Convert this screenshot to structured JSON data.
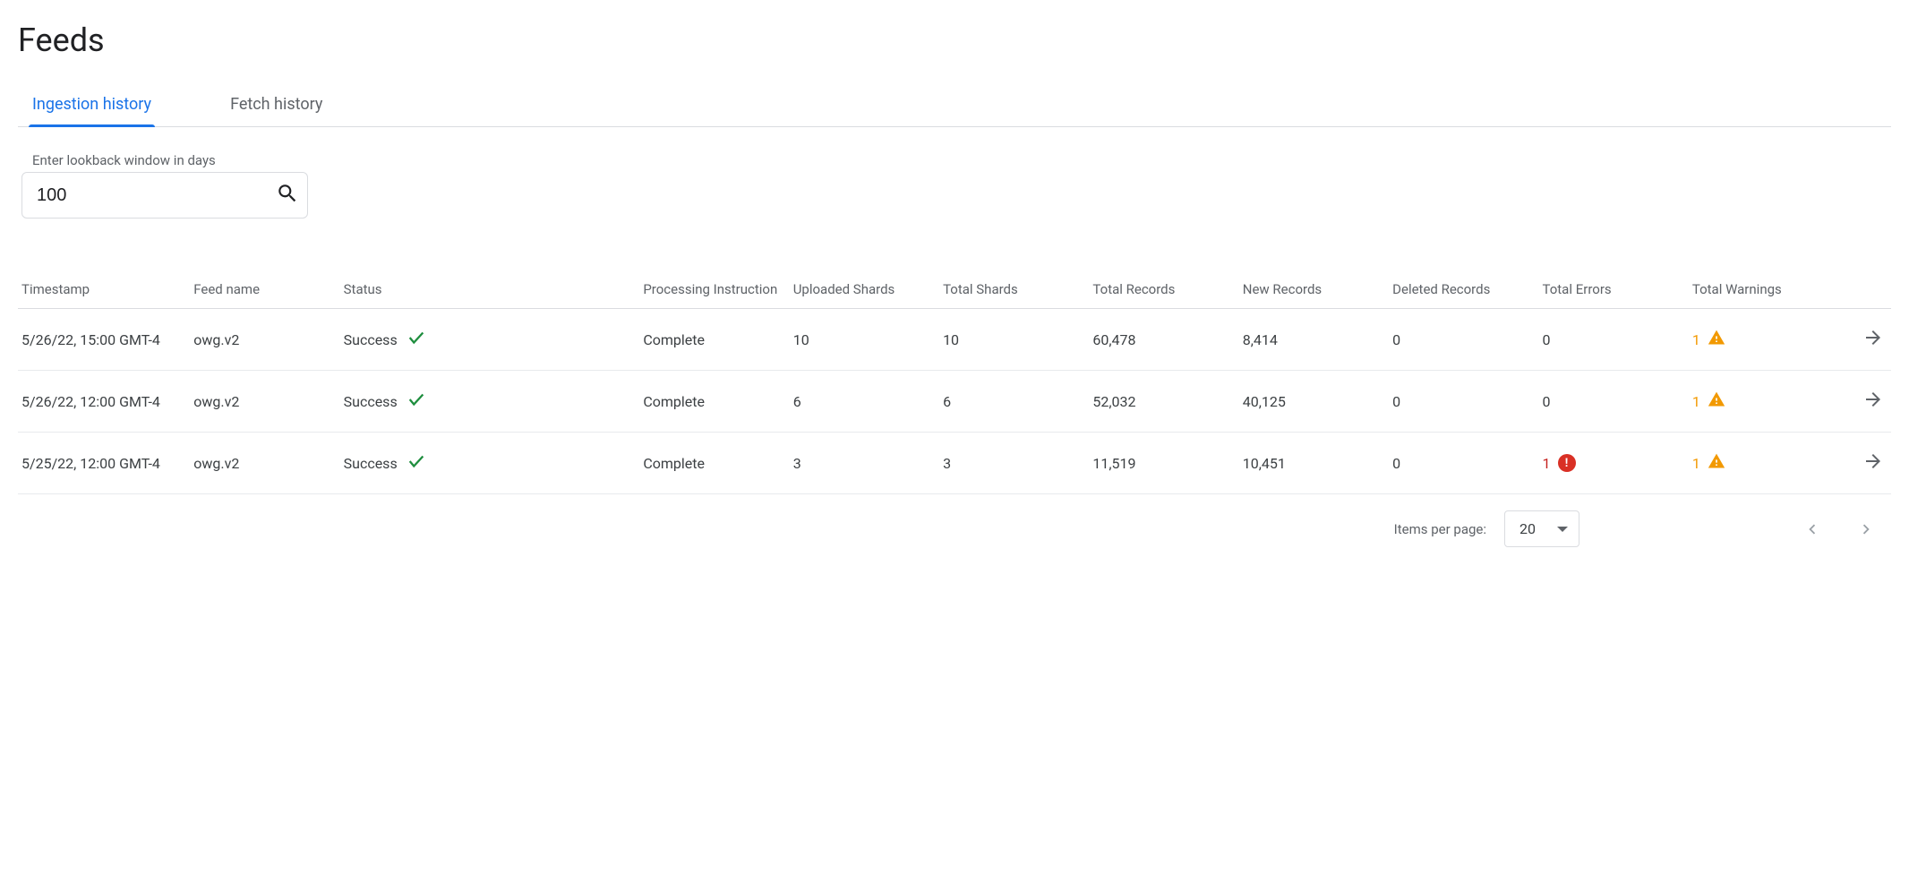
{
  "title": "Feeds",
  "tabs": [
    {
      "label": "Ingestion history",
      "active": true
    },
    {
      "label": "Fetch history",
      "active": false
    }
  ],
  "lookback": {
    "label": "Enter lookback window in days",
    "value": "100"
  },
  "columns": [
    "Timestamp",
    "Feed name",
    "Status",
    "Processing Instruction",
    "Uploaded Shards",
    "Total Shards",
    "Total Records",
    "New Records",
    "Deleted Records",
    "Total Errors",
    "Total Warnings"
  ],
  "rows": [
    {
      "timestamp": "5/26/22, 15:00 GMT-4",
      "feed_name": "owg.v2",
      "status": "Success",
      "processing_instruction": "Complete",
      "uploaded_shards": "10",
      "total_shards": "10",
      "total_records": "60,478",
      "new_records": "8,414",
      "deleted_records": "0",
      "total_errors": "0",
      "total_warnings": "1",
      "has_error_icon": false,
      "has_warning_icon": true
    },
    {
      "timestamp": "5/26/22, 12:00 GMT-4",
      "feed_name": "owg.v2",
      "status": "Success",
      "processing_instruction": "Complete",
      "uploaded_shards": "6",
      "total_shards": "6",
      "total_records": "52,032",
      "new_records": "40,125",
      "deleted_records": "0",
      "total_errors": "0",
      "total_warnings": "1",
      "has_error_icon": false,
      "has_warning_icon": true
    },
    {
      "timestamp": "5/25/22, 12:00 GMT-4",
      "feed_name": "owg.v2",
      "status": "Success",
      "processing_instruction": "Complete",
      "uploaded_shards": "3",
      "total_shards": "3",
      "total_records": "11,519",
      "new_records": "10,451",
      "deleted_records": "0",
      "total_errors": "1",
      "total_warnings": "1",
      "has_error_icon": true,
      "has_warning_icon": true
    }
  ],
  "pager": {
    "label": "Items per page:",
    "value": "20"
  }
}
